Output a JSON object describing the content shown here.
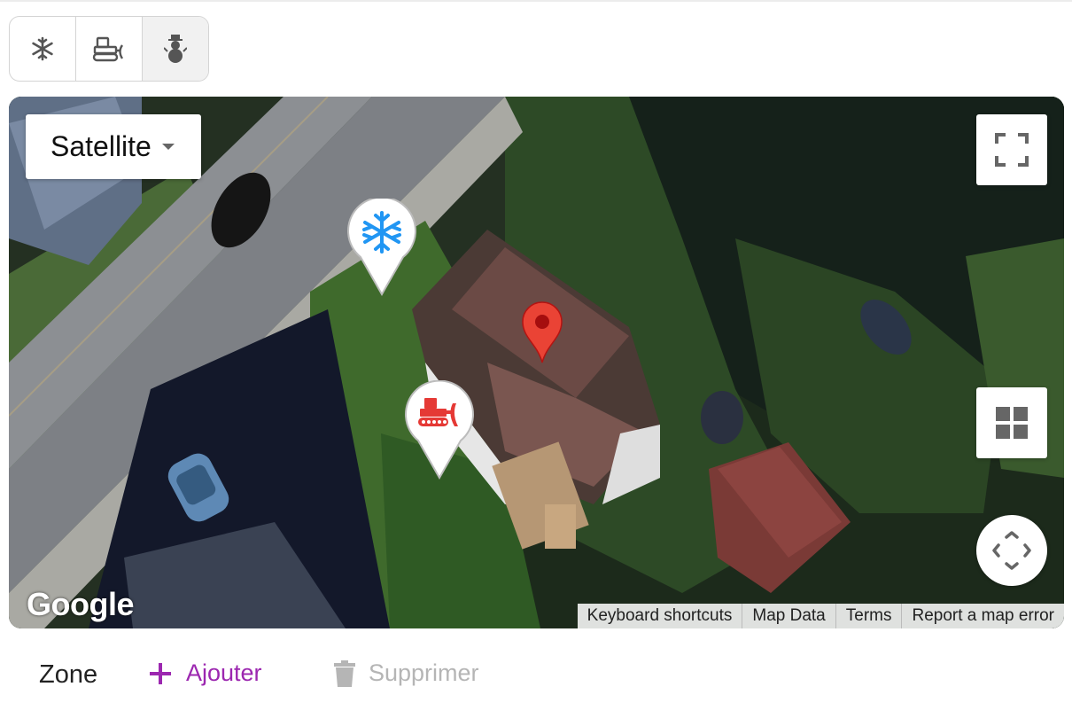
{
  "toolbar": {
    "items": [
      {
        "icon": "snowflake-icon"
      },
      {
        "icon": "snowplow-icon"
      },
      {
        "icon": "snowman-icon"
      }
    ]
  },
  "map": {
    "map_type": "Satellite",
    "markers": [
      {
        "icon": "snowflake-icon",
        "color": "#2196f3"
      },
      {
        "icon": "snowplow-icon",
        "color": "#e53935"
      },
      {
        "icon": "location-pin-icon",
        "color": "#ea4335"
      }
    ],
    "logo": "Google",
    "attribution": {
      "keyboard_shortcuts": "Keyboard shortcuts",
      "map_data": "Map Data",
      "terms": "Terms",
      "report": "Report a map error"
    }
  },
  "bottom": {
    "zone_label": "Zone",
    "add_label": "Ajouter",
    "delete_label": "Supprimer"
  },
  "colors": {
    "accent": "#9c27b0",
    "disabled": "#b5b5b5"
  }
}
